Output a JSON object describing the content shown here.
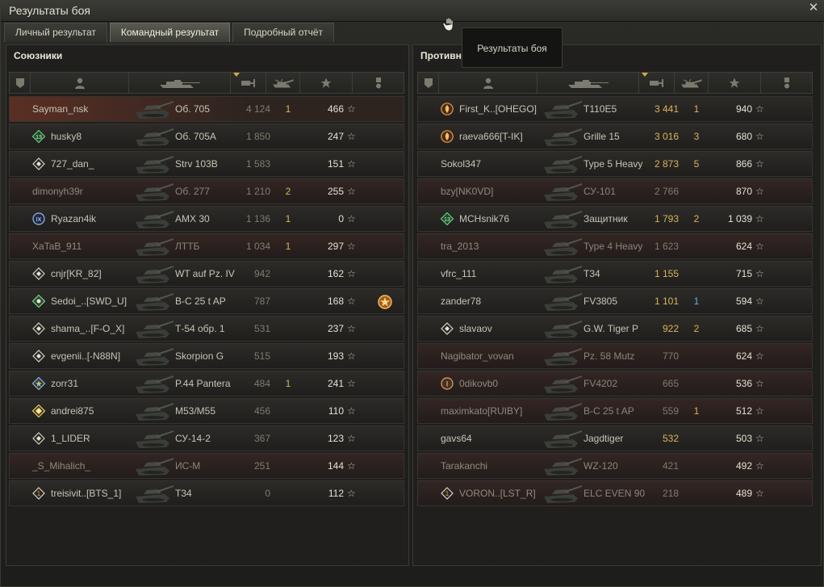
{
  "window": {
    "title": "Результаты боя",
    "close_label": "✕"
  },
  "tabs": [
    {
      "label": "Личный результат"
    },
    {
      "label": "Командный результат"
    },
    {
      "label": "Подробный отчёт"
    }
  ],
  "tooltip": "Результаты боя",
  "allies": {
    "title": "Союзники",
    "rows": [
      {
        "name": "Sayman_nsk",
        "tank": "Об. 705",
        "damage": "4 124",
        "kills": "1",
        "xp": "466",
        "badge": null,
        "state": "self",
        "dmg_hi": false
      },
      {
        "name": "husky8",
        "tank": "Об. 705А",
        "damage": "1 850",
        "kills": "",
        "xp": "247",
        "badge": "13",
        "state": "alive",
        "dmg_hi": false
      },
      {
        "name": "727_dan_",
        "tank": "Strv 103B",
        "damage": "1 583",
        "kills": "",
        "xp": "151",
        "badge": "diamond",
        "state": "alive",
        "dmg_hi": false
      },
      {
        "name": "dimonyh39r",
        "tank": "Об. 277",
        "damage": "1 210",
        "kills": "2",
        "xp": "255",
        "badge": null,
        "state": "dead",
        "dmg_hi": false
      },
      {
        "name": "Ryazan4ik",
        "tank": "AMX 30",
        "damage": "1 136",
        "kills": "1",
        "xp": "0",
        "badge": "IX",
        "state": "alive",
        "dmg_hi": false
      },
      {
        "name": "XaTaB_911",
        "tank": "ЛТТБ",
        "damage": "1 034",
        "kills": "1",
        "xp": "297",
        "badge": null,
        "state": "dead",
        "dmg_hi": false
      },
      {
        "name": "cnjr[KR_82]",
        "tank": "WT auf Pz. IV",
        "damage": "942",
        "kills": "",
        "xp": "162",
        "badge": "diamond",
        "state": "alive",
        "dmg_hi": false
      },
      {
        "name": "Sedoi_..[SWD_U]",
        "tank": "В-С 25 t AP",
        "damage": "787",
        "kills": "",
        "xp": "168",
        "badge": "green",
        "state": "alive",
        "dmg_hi": false,
        "medal": true
      },
      {
        "name": "shama_..[F-O_X]",
        "tank": "Т-54 обр. 1",
        "damage": "531",
        "kills": "",
        "xp": "237",
        "badge": "diamond",
        "state": "alive",
        "dmg_hi": false
      },
      {
        "name": "evgenii..[-N88N]",
        "tank": "Skorpion G",
        "damage": "515",
        "kills": "",
        "xp": "193",
        "badge": "diamond",
        "state": "alive",
        "dmg_hi": false
      },
      {
        "name": "zorr31",
        "tank": "P.44 Pantera",
        "damage": "484",
        "kills": "1",
        "xp": "241",
        "badge": "star",
        "state": "alive",
        "dmg_hi": false
      },
      {
        "name": "andrei875",
        "tank": "M53/M55",
        "damage": "456",
        "kills": "",
        "xp": "110",
        "badge": "gold",
        "state": "alive",
        "dmg_hi": false
      },
      {
        "name": "1_LIDER",
        "tank": "СУ-14-2",
        "damage": "367",
        "kills": "",
        "xp": "123",
        "badge": "diamond",
        "state": "alive",
        "dmg_hi": false
      },
      {
        "name": "_S_Mihalich_",
        "tank": "ИС-М",
        "damage": "251",
        "kills": "",
        "xp": "144",
        "badge": null,
        "state": "dead",
        "dmg_hi": false
      },
      {
        "name": "treisivit..[BTS_1]",
        "tank": "T34",
        "damage": "0",
        "kills": "",
        "xp": "112",
        "badge": "diamond1",
        "state": "alive",
        "dmg_hi": false
      }
    ]
  },
  "enemies": {
    "title": "Противники",
    "rows": [
      {
        "name": "First_K..[OHEGO]",
        "tank": "T110E5",
        "damage": "3 441",
        "kills": "1",
        "xp": "940",
        "badge": "flame",
        "state": "alive",
        "dmg_hi": true
      },
      {
        "name": "raeva666[T-IK]",
        "tank": "Grille 15",
        "damage": "3 016",
        "kills": "3",
        "xp": "680",
        "badge": "flame",
        "state": "alive",
        "dmg_hi": true
      },
      {
        "name": "Sokol347",
        "tank": "Type 5 Heavy",
        "damage": "2 873",
        "kills": "5",
        "xp": "866",
        "badge": null,
        "state": "alive",
        "dmg_hi": true
      },
      {
        "name": "bzy[NK0VD]",
        "tank": "СУ-101",
        "damage": "2 766",
        "kills": "",
        "xp": "870",
        "badge": null,
        "state": "dead",
        "dmg_hi": false
      },
      {
        "name": "MCHsnik76",
        "tank": "Защитник",
        "damage": "1 793",
        "kills": "2",
        "xp": "1 039",
        "badge": "13",
        "state": "alive",
        "dmg_hi": true
      },
      {
        "name": "tra_2013",
        "tank": "Type 4 Heavy",
        "damage": "1 623",
        "kills": "",
        "xp": "624",
        "badge": null,
        "state": "dead",
        "dmg_hi": false
      },
      {
        "name": "vfrc_111",
        "tank": "T34",
        "damage": "1 155",
        "kills": "",
        "xp": "715",
        "badge": null,
        "state": "alive",
        "dmg_hi": true
      },
      {
        "name": "zander78",
        "tank": "FV3805",
        "damage": "1 101",
        "kills": "1",
        "xp": "594",
        "badge": null,
        "state": "alive",
        "dmg_hi": true,
        "kills_blue": true
      },
      {
        "name": "slavaov",
        "tank": "G.W. Tiger P",
        "damage": "922",
        "kills": "2",
        "xp": "685",
        "badge": "diamond",
        "state": "alive",
        "dmg_hi": true
      },
      {
        "name": "Nagibator_vovan",
        "tank": "Pz. 58 Mutz",
        "damage": "770",
        "kills": "",
        "xp": "624",
        "badge": null,
        "state": "dead",
        "dmg_hi": false
      },
      {
        "name": "0dikovb0",
        "tank": "FV4202",
        "damage": "665",
        "kills": "",
        "xp": "536",
        "badge": "I",
        "state": "dead",
        "dmg_hi": false
      },
      {
        "name": "maximkato[RUIBY]",
        "tank": "В-С 25 t AP",
        "damage": "559",
        "kills": "1",
        "xp": "512",
        "badge": null,
        "state": "dead",
        "dmg_hi": false
      },
      {
        "name": "gavs64",
        "tank": "Jagdtiger",
        "damage": "532",
        "kills": "",
        "xp": "503",
        "badge": null,
        "state": "alive",
        "dmg_hi": true
      },
      {
        "name": "Tarakanchi",
        "tank": "WZ-120",
        "damage": "421",
        "kills": "",
        "xp": "492",
        "badge": null,
        "state": "dead",
        "dmg_hi": false
      },
      {
        "name": "VORON..[LST_R]",
        "tank": "ELC EVEN 90",
        "damage": "218",
        "kills": "",
        "xp": "489",
        "badge": "diamond1",
        "state": "dead",
        "dmg_hi": false
      }
    ]
  },
  "star_glyph": "☆"
}
